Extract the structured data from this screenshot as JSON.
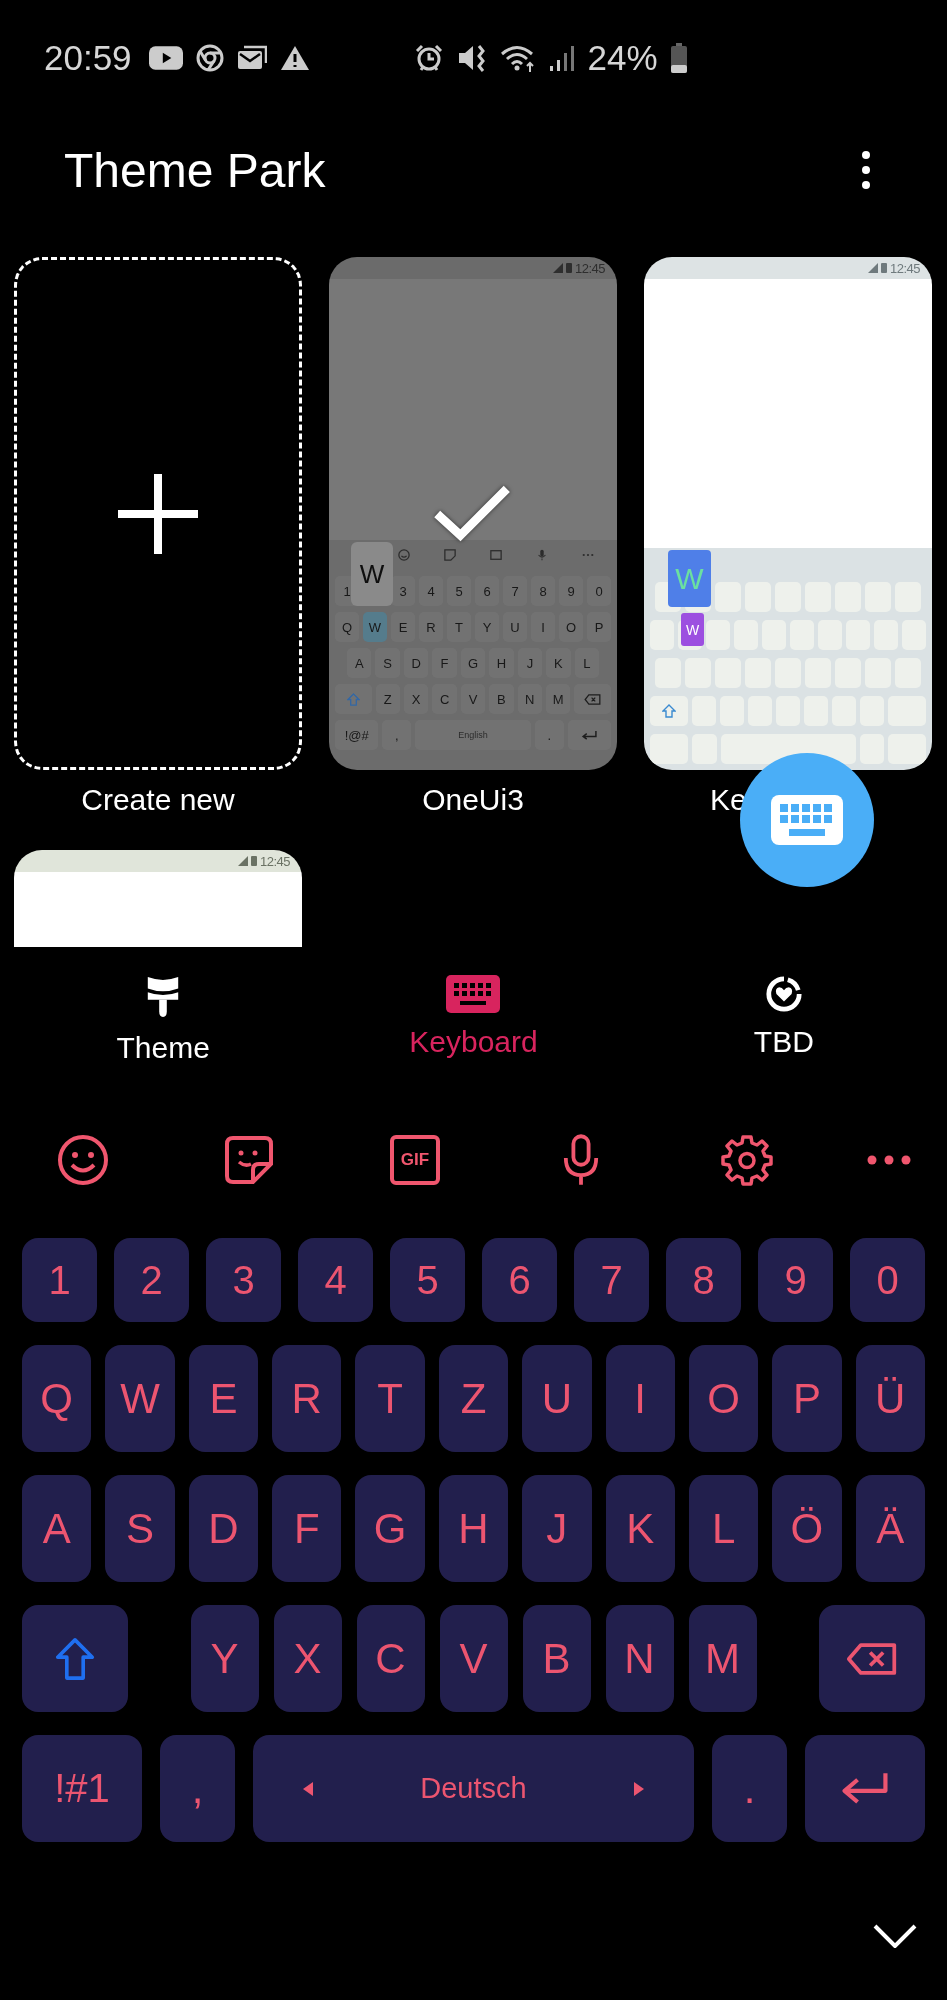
{
  "status_bar": {
    "time": "20:59",
    "battery_text": "24%"
  },
  "app_bar": {
    "title": "Theme Park"
  },
  "themes": [
    {
      "kind": "create",
      "label": "Create new"
    },
    {
      "kind": "dark",
      "label": "OneUi3",
      "selected": true,
      "clock": "12:45",
      "keyboard": {
        "key_rows": [
          [
            "1",
            {
              "kind": "popup",
              "label": "W"
            },
            "3",
            "4",
            "5",
            "6",
            "7",
            "8",
            "9",
            "0"
          ],
          [
            "Q",
            {
              "kind": "char",
              "label": "W",
              "pressed": true
            },
            "E",
            "R",
            "T",
            "Y",
            "U",
            "I",
            "O",
            "P"
          ],
          [
            "A",
            "S",
            "D",
            "F",
            "G",
            "H",
            "J",
            "K",
            "L"
          ],
          [
            {
              "kind": "shift"
            },
            "Z",
            "X",
            "C",
            "V",
            "B",
            "N",
            "M",
            {
              "kind": "backspace"
            }
          ],
          [
            {
              "kind": "mod",
              "label": "!@#"
            },
            ",",
            {
              "kind": "space",
              "label": "English"
            },
            ".",
            {
              "kind": "enter"
            }
          ]
        ]
      }
    },
    {
      "kind": "light",
      "label": "Ke",
      "selected": false,
      "clock": "12:45",
      "popup": "W",
      "pressed_key": "W"
    },
    {
      "kind": "partial",
      "selected": false,
      "clock": "12:45"
    }
  ],
  "tabs": [
    {
      "kind": "theme",
      "label": "Theme",
      "selected": false
    },
    {
      "kind": "keyboard",
      "label": "Keyboard",
      "selected": true
    },
    {
      "kind": "tbd",
      "label": "TBD",
      "selected": false
    }
  ],
  "keyboard": {
    "toolbar": [
      {
        "kind": "emoji"
      },
      {
        "kind": "sticker"
      },
      {
        "kind": "gif",
        "label": "GIF"
      },
      {
        "kind": "mic"
      },
      {
        "kind": "settings"
      },
      {
        "kind": "more"
      }
    ],
    "key_rows": [
      [
        "1",
        "2",
        "3",
        "4",
        "5",
        "6",
        "7",
        "8",
        "9",
        "0"
      ],
      [
        "Q",
        "W",
        "E",
        "R",
        "T",
        "Z",
        "U",
        "I",
        "O",
        "P",
        "Ü"
      ],
      [
        "A",
        "S",
        "D",
        "F",
        "G",
        "H",
        "J",
        "K",
        "L",
        "Ö",
        "Ä"
      ],
      [
        {
          "kind": "shift"
        },
        "Y",
        "X",
        "C",
        "V",
        "B",
        "N",
        "M",
        {
          "kind": "backspace"
        }
      ],
      [
        {
          "kind": "mod",
          "label": "!#1"
        },
        ",",
        {
          "kind": "space",
          "label": "Deutsch"
        },
        ".",
        {
          "kind": "enter"
        }
      ]
    ]
  }
}
